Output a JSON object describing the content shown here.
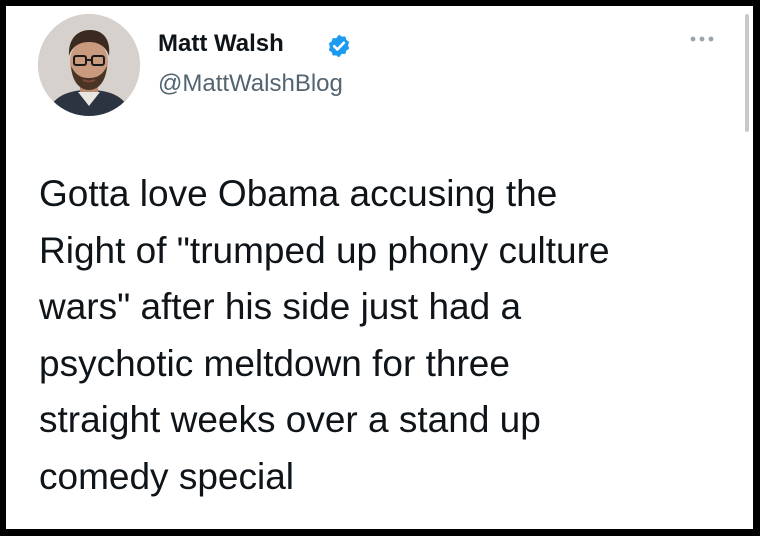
{
  "author": {
    "display_name": "Matt Walsh",
    "handle": "@MattWalshBlog",
    "verified_icon": "verified-badge-icon",
    "avatar": "profile-photo"
  },
  "menu": {
    "icon": "more-options-icon"
  },
  "tweet": {
    "lines": [
      "Gotta love Obama accusing the",
      "Right of \"trumped up phony culture",
      "wars\" after his side just had a",
      "psychotic meltdown for three",
      "straight weeks over a stand up",
      "comedy special"
    ]
  },
  "colors": {
    "verified_blue": "#1d9bf0",
    "text_primary": "#0f1419",
    "text_secondary": "#536471"
  }
}
